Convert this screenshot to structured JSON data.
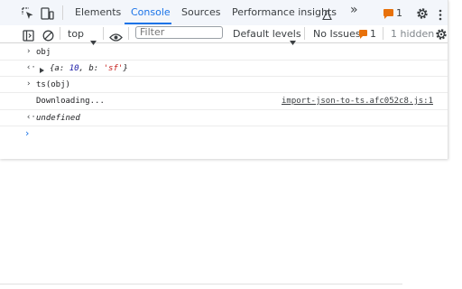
{
  "tabs": {
    "elements": "Elements",
    "console": "Console",
    "sources": "Sources",
    "performance_insights": "Performance insights",
    "more": "»",
    "issues_count": "1"
  },
  "toolbar": {
    "context": "top",
    "filter_placeholder": "Filter",
    "levels": "Default levels",
    "no_issues": "No Issues",
    "issues_count": "1",
    "hidden": "1 hidden"
  },
  "console": {
    "entries": [
      {
        "kind": "input",
        "text": "obj"
      },
      {
        "kind": "result",
        "preview": {
          "open": "{",
          "a_key": "a: ",
          "a_val": "10",
          "sep": ", ",
          "b_key": "b: ",
          "b_val": "'sf'",
          "close": "}"
        }
      },
      {
        "kind": "input",
        "text": "ts(obj)"
      },
      {
        "kind": "log",
        "text": "Downloading...",
        "source": "import-json-to-ts.afc052c8.js:1"
      },
      {
        "kind": "result",
        "text": "undefined"
      }
    ]
  },
  "colors": {
    "accent": "#1a73e8",
    "warning": "#e8710a"
  }
}
